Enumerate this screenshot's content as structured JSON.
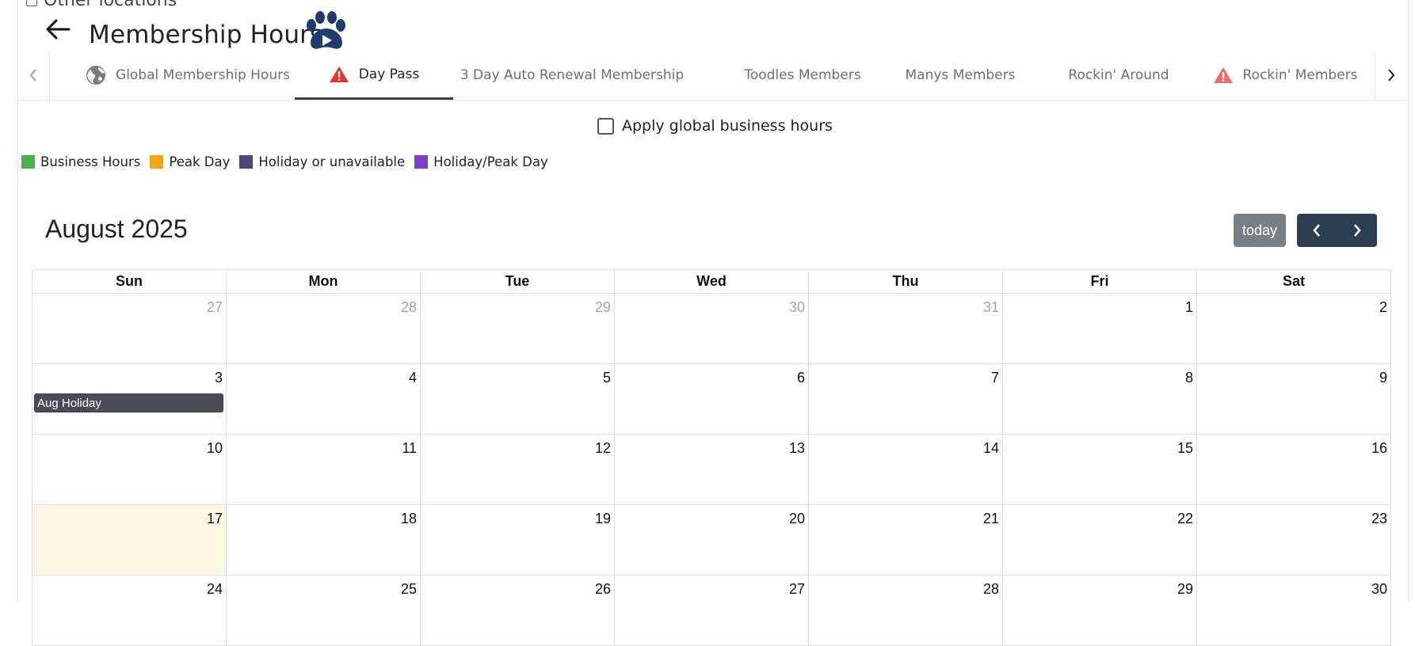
{
  "header": {
    "other_locations": "Other locations",
    "title": "Membership Hours",
    "logo_icon": "paw-play-icon"
  },
  "tabs": [
    {
      "label": "Global Membership Hours",
      "icon": "globe-icon",
      "active": false
    },
    {
      "label": "Day Pass",
      "icon": "warning-icon",
      "active": true
    },
    {
      "label": "3 Day Auto Renewal Membership",
      "icon": null,
      "active": false
    },
    {
      "label": "Toodles Members",
      "icon": null,
      "active": false
    },
    {
      "label": "Manys Members",
      "icon": null,
      "active": false
    },
    {
      "label": "Rockin' Around",
      "icon": null,
      "active": false
    },
    {
      "label": "Rockin' Members",
      "icon": "warning-icon",
      "active": false
    }
  ],
  "apply_global": {
    "label": "Apply global business hours",
    "checked": false
  },
  "legend": [
    {
      "label": "Business Hours",
      "color": "#4caf50"
    },
    {
      "label": "Peak Day",
      "color": "#ffa500"
    },
    {
      "label": "Holiday or unavailable",
      "color": "#4a4a7a"
    },
    {
      "label": "Holiday/Peak Day",
      "color": "#7b3fcf"
    }
  ],
  "calendar": {
    "month_title": "August 2025",
    "today_label": "today",
    "weekdays": [
      "Sun",
      "Mon",
      "Tue",
      "Wed",
      "Thu",
      "Fri",
      "Sat"
    ],
    "weeks": [
      [
        "27",
        "28",
        "29",
        "30",
        "31",
        "1",
        "2"
      ],
      [
        "3",
        "4",
        "5",
        "6",
        "7",
        "8",
        "9"
      ],
      [
        "10",
        "11",
        "12",
        "13",
        "14",
        "15",
        "16"
      ],
      [
        "17",
        "18",
        "19",
        "20",
        "21",
        "22",
        "23"
      ],
      [
        "24",
        "25",
        "26",
        "27",
        "28",
        "29",
        "30"
      ]
    ],
    "events": {
      "aug_holiday": "Aug Holiday"
    }
  },
  "colors": {
    "accent_dark": "#2c3e50",
    "today_highlight": "#fcf8e3",
    "warning_red": "#e8312a"
  }
}
